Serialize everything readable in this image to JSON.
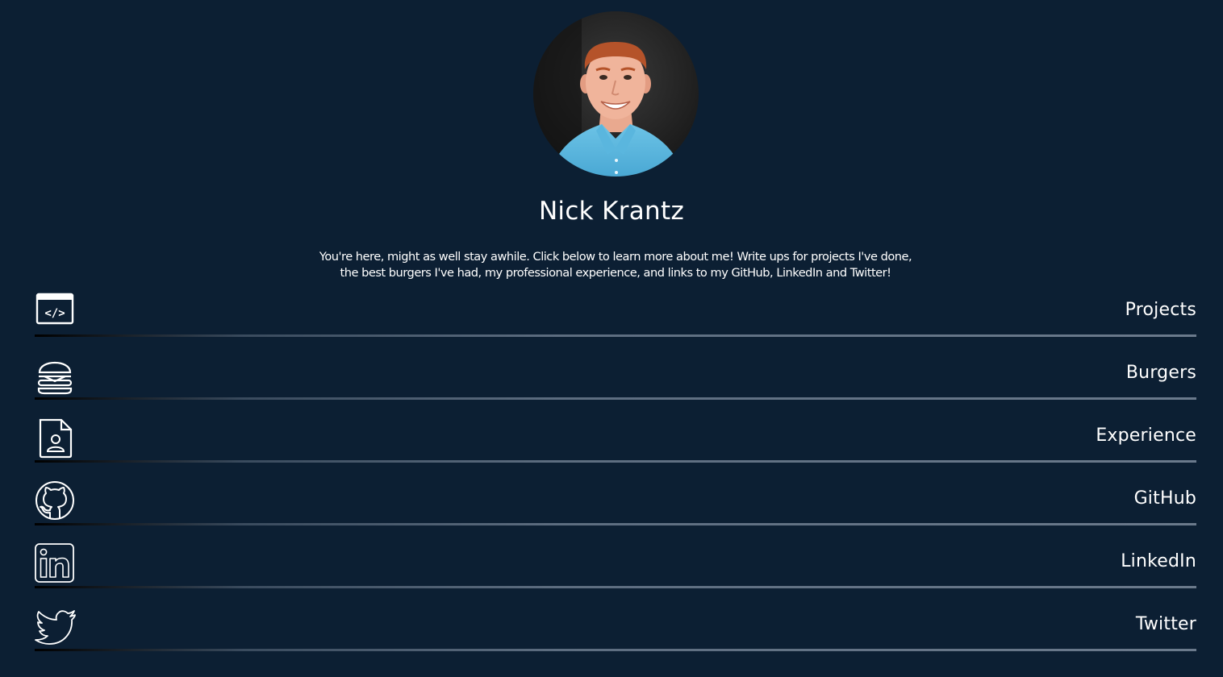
{
  "profile": {
    "name": "Nick Krantz",
    "intro_line1": "You're here, might as well stay awhile. Click below to learn more about me! Write ups for projects I've done,",
    "intro_line2": "the best burgers I've had, my professional experience, and links to my GitHub, LinkedIn and Twitter!"
  },
  "links": [
    {
      "label": "Projects",
      "icon": "code-window-icon"
    },
    {
      "label": "Burgers",
      "icon": "burger-icon"
    },
    {
      "label": "Experience",
      "icon": "resume-document-icon"
    },
    {
      "label": "GitHub",
      "icon": "github-icon"
    },
    {
      "label": "LinkedIn",
      "icon": "linkedin-icon"
    },
    {
      "label": "Twitter",
      "icon": "twitter-icon"
    }
  ],
  "colors": {
    "background": "#0c1f33",
    "text": "#ffffff",
    "rule": "#6b7a8c"
  }
}
